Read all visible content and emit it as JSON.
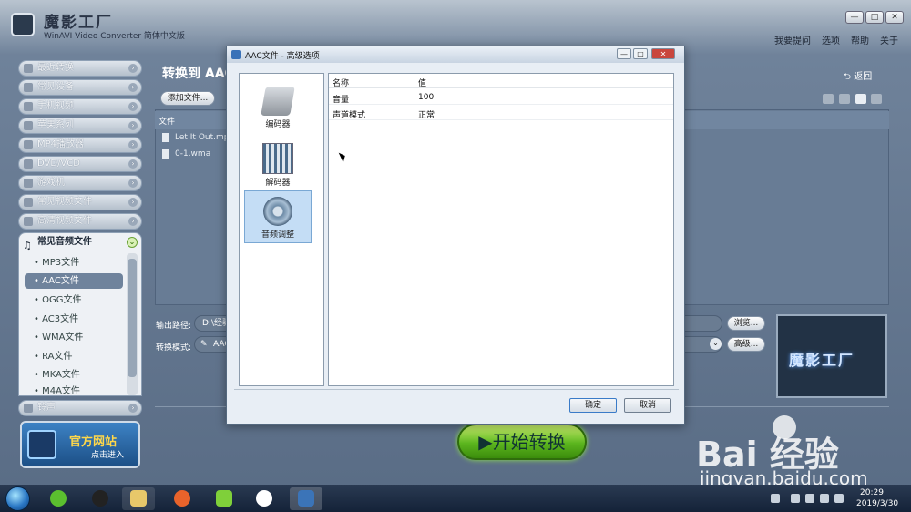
{
  "app": {
    "title": "魔影工厂",
    "subtitle": "WinAVI Video Converter 简体中文版",
    "menu": [
      "我要提问",
      "选项",
      "帮助",
      "关于"
    ]
  },
  "sidebar": {
    "categories": [
      {
        "label": "最近转换",
        "icon": "clock-icon"
      },
      {
        "label": "常见设备",
        "icon": "device-icon"
      },
      {
        "label": "手机视频",
        "icon": "phone-icon"
      },
      {
        "label": "苹果系列",
        "icon": "apple-icon"
      },
      {
        "label": "MP4播放器",
        "icon": "mp4-icon"
      },
      {
        "label": "DVD/VCD",
        "icon": "disc-icon"
      },
      {
        "label": "游戏机",
        "icon": "gamepad-icon"
      },
      {
        "label": "常见视频文件",
        "icon": "film-icon"
      },
      {
        "label": "高清视频文件",
        "icon": "hd-icon"
      }
    ],
    "open_category": "常见音频文件",
    "formats": [
      "MP3文件",
      "AAC文件",
      "OGG文件",
      "AC3文件",
      "WMA文件",
      "RA文件",
      "MKA文件",
      "M4A文件"
    ],
    "selected_format": "AAC文件",
    "last_category": "铃声",
    "official": {
      "title": "官方网站",
      "sub": "点击进入"
    }
  },
  "main": {
    "title": "转换到 AAC",
    "back": "返回",
    "add_file": "添加文件...",
    "file_column": "文件",
    "files": [
      "Let It Out.mp",
      "0-1.wma"
    ],
    "output_label": "输出路径:",
    "output_value": "D:\\经验",
    "mode_label": "转换模式:",
    "mode_value": "AAC",
    "browse": "浏览...",
    "advanced": "高级...",
    "preview_logo": "魔影工厂",
    "start": "▶开始转换"
  },
  "dialog": {
    "title": "AAC文件 - 高级选项",
    "categories": [
      {
        "label": "编码器",
        "icon": "encoder-icon"
      },
      {
        "label": "解码器",
        "icon": "decoder-icon"
      },
      {
        "label": "音频调整",
        "icon": "audio-speaker-icon"
      }
    ],
    "selected_category": "音频调整",
    "columns": [
      "名称",
      "值"
    ],
    "rows": [
      {
        "name": "音量",
        "value": "100"
      },
      {
        "name": "声道模式",
        "value": "正常"
      }
    ],
    "ok": "确定",
    "cancel": "取消"
  },
  "taskbar": {
    "time": "20:29",
    "date": "2019/3/30"
  },
  "watermark": {
    "brand": "Bai  经验",
    "url": "jingyan.baidu.com"
  }
}
